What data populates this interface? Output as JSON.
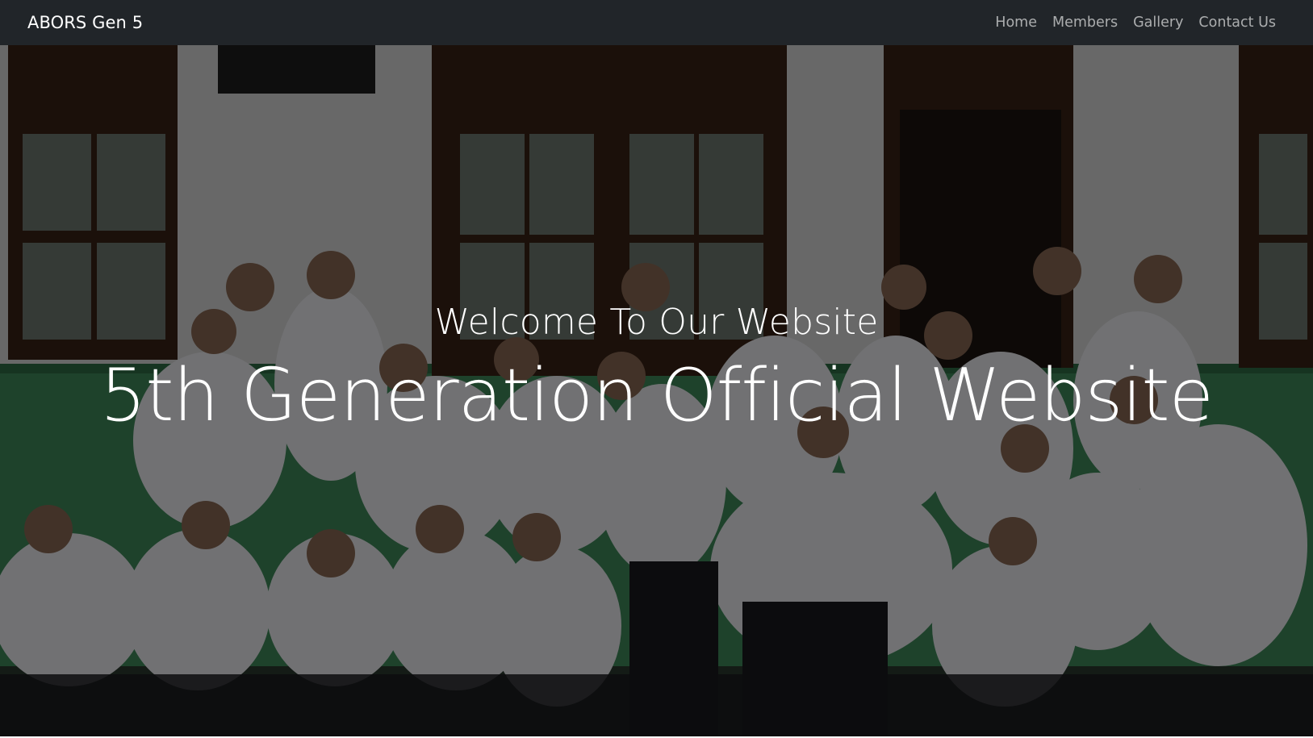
{
  "navbar": {
    "brand": "ABORS Gen 5",
    "links": [
      {
        "label": "Home"
      },
      {
        "label": "Members"
      },
      {
        "label": "Gallery"
      },
      {
        "label": "Contact Us"
      }
    ]
  },
  "hero": {
    "subtitle": "Welcome To Our Website",
    "title": "5th Generation Official Website",
    "background_image": "group-photo-of-students-in-white-uniforms-in-front-of-building"
  },
  "colors": {
    "navbar_bg": "#212529",
    "nav_link": "rgba(255,255,255,0.62)",
    "hero_text": "#ffffff"
  }
}
